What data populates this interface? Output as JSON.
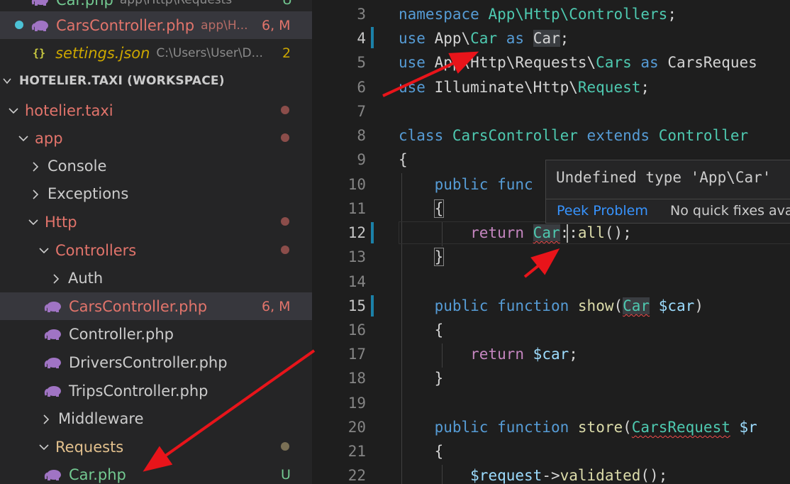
{
  "sidebar": {
    "open_editors": [
      {
        "name": "Car.php",
        "path": "app\\Http\\Requests",
        "status": "U"
      },
      {
        "name": "CarsController.php",
        "path": "app\\H...",
        "status": "6, M"
      },
      {
        "name": "settings.json",
        "path": "C:\\Users\\User\\D...",
        "status": "2"
      }
    ],
    "workspace_title": "HOTELIER.TAXI (WORKSPACE)",
    "tree": {
      "root": "hotelier.taxi",
      "app": "app",
      "console": "Console",
      "exceptions": "Exceptions",
      "http": "Http",
      "controllers": "Controllers",
      "auth": "Auth",
      "files": [
        {
          "name": "CarsController.php",
          "status": "6, M"
        },
        {
          "name": "Controller.php",
          "status": ""
        },
        {
          "name": "DriversController.php",
          "status": ""
        },
        {
          "name": "TripsController.php",
          "status": ""
        }
      ],
      "middleware": "Middleware",
      "requests": "Requests",
      "car_php": {
        "name": "Car.php",
        "status": "U"
      }
    }
  },
  "editor": {
    "line_numbers": [
      "3",
      "4",
      "5",
      "6",
      "7",
      "8",
      "9",
      "10",
      "11",
      "12",
      "13",
      "14",
      "15",
      "16",
      "17",
      "18",
      "19",
      "20",
      "21",
      "22"
    ],
    "hover": {
      "message": "Undefined type 'App\\Car'",
      "peek_label": "Peek Problem",
      "quick_fix_label": "No quick fixes ava"
    }
  },
  "colors": {
    "accent_error": "#f14c4c",
    "modified_file": "#e2746b",
    "untracked_file": "#73c991",
    "annotation_arrow": "#e8141a"
  },
  "icons": [
    "php-elephant-icon",
    "json-braces-icon",
    "chevron-right-icon",
    "chevron-down-icon",
    "unsaved-dot-icon"
  ]
}
